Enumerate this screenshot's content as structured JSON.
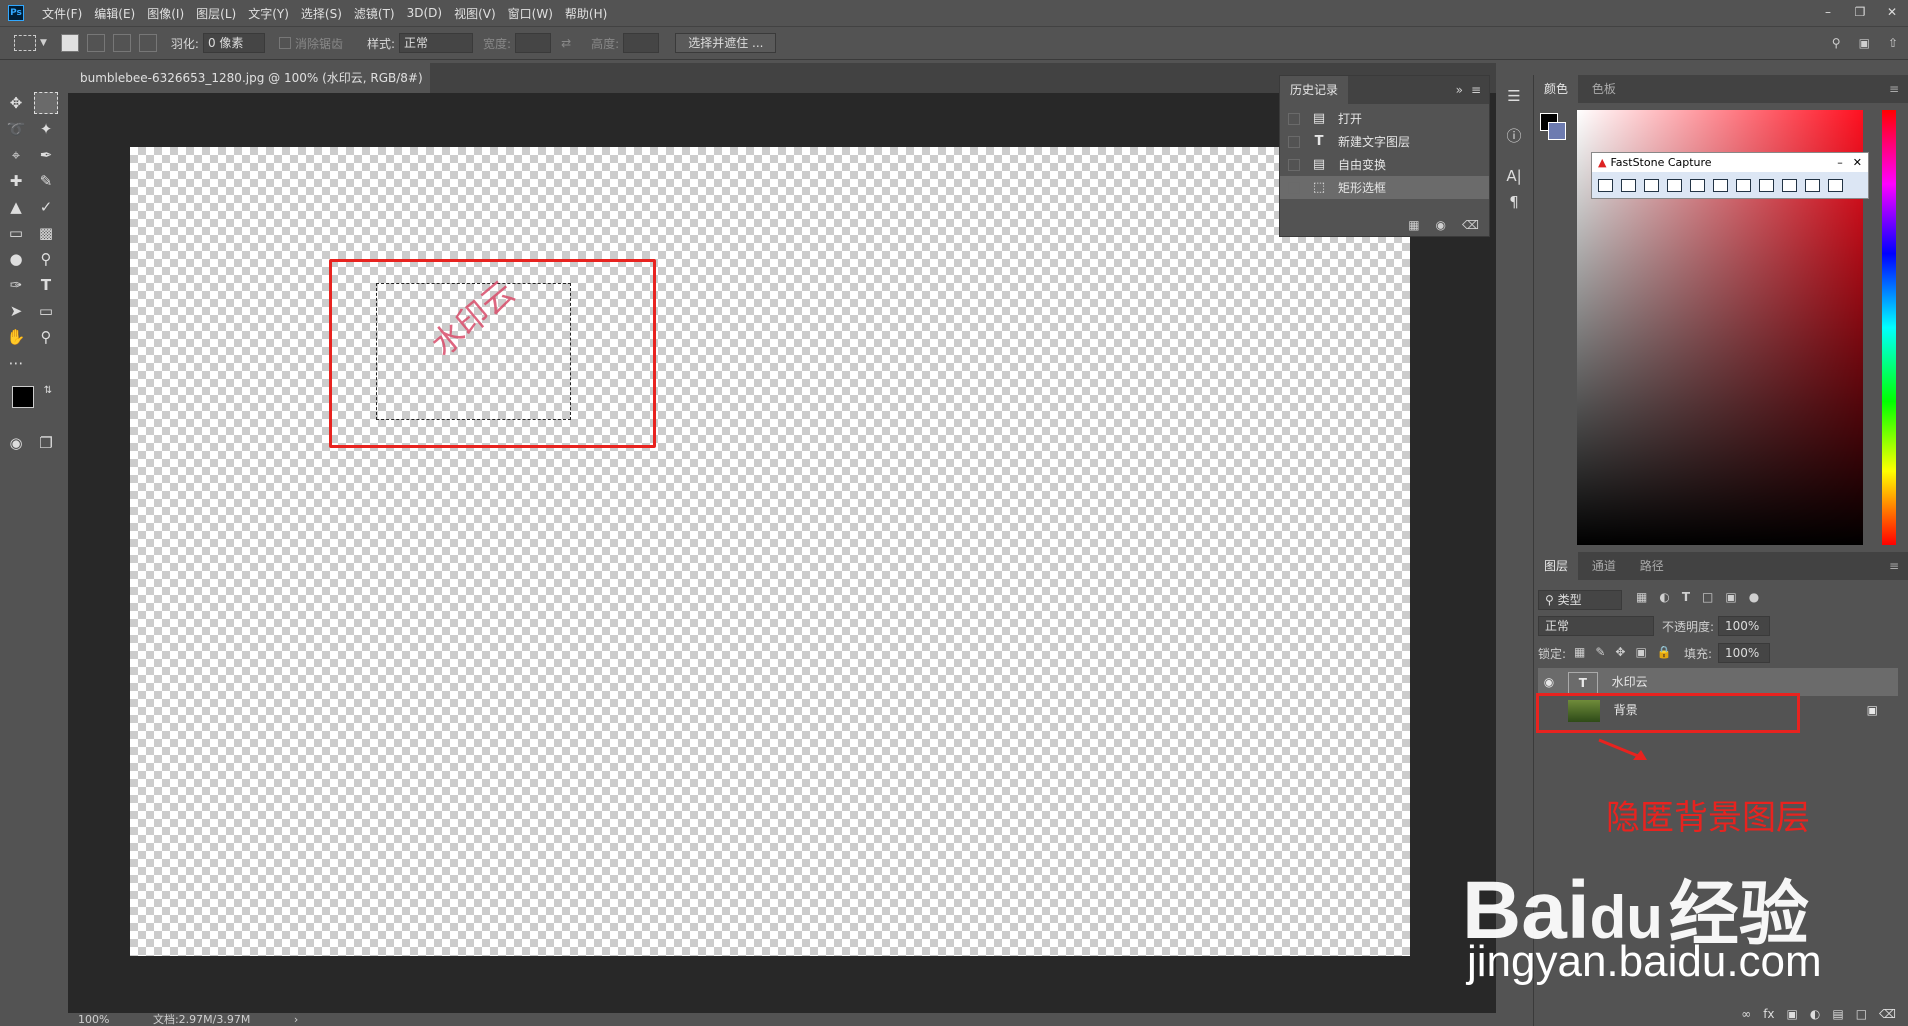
{
  "menu": {
    "logo": "Ps",
    "items": [
      "文件(F)",
      "编辑(E)",
      "图像(I)",
      "图层(L)",
      "文字(Y)",
      "选择(S)",
      "滤镜(T)",
      "3D(D)",
      "视图(V)",
      "窗口(W)",
      "帮助(H)"
    ]
  },
  "options": {
    "feather_label": "羽化:",
    "feather_value": "0 像素",
    "antialias_label": "消除锯齿",
    "style_label": "样式:",
    "style_value": "正常",
    "width_label": "宽度:",
    "height_label": "高度:",
    "select_mask_button": "选择并遮住 ..."
  },
  "document": {
    "tab_title": "bumblebee-6326653_1280.jpg @ 100% (水印云, RGB/8#) *",
    "watermark_text": "水印云"
  },
  "status": {
    "zoom": "100%",
    "doc_size": "文档:2.97M/3.97M"
  },
  "history": {
    "tab": "历史记录",
    "items": [
      {
        "icon": "document-icon",
        "label": "打开"
      },
      {
        "icon": "type-icon",
        "label": "新建文字图层"
      },
      {
        "icon": "document-icon",
        "label": "自由变换"
      },
      {
        "icon": "marquee-icon",
        "label": "矩形选框"
      }
    ],
    "selected_index": 3
  },
  "color_panel": {
    "tabs": [
      "颜色",
      "色板"
    ],
    "foreground": "#000000",
    "background": "#6d7bb0"
  },
  "faststone": {
    "title": "FastStone Capture"
  },
  "layers_panel": {
    "tabs": [
      "图层",
      "通道",
      "路径"
    ],
    "filter_value": "类型",
    "blend_mode": "正常",
    "opacity_label": "不透明度:",
    "opacity_value": "100%",
    "lock_label": "锁定:",
    "fill_label": "填充:",
    "fill_value": "100%",
    "layers": [
      {
        "name": "水印云",
        "type": "text",
        "visible": true
      },
      {
        "name": "背景",
        "type": "image",
        "visible": false,
        "locked": true
      }
    ]
  },
  "annotation": {
    "text": "隐匿背景图层",
    "color": "#e8231f"
  },
  "watermark": {
    "brand": "Bai",
    "brand_cn": "经验",
    "url": "jingyan.baidu.com"
  }
}
